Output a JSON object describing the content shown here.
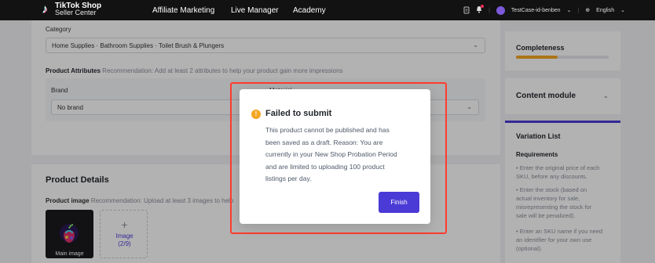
{
  "colors": {
    "accent": "#4b3bd6",
    "warning": "#f5a623",
    "highlight": "#ff3b30",
    "topbar": "#121212"
  },
  "topbar": {
    "logo_line1": "TikTok Shop",
    "logo_line2": "Seller Center",
    "nav": [
      "Affiliate Marketing",
      "Live Manager",
      "Academy"
    ],
    "store_name": "TestCase-id-benben",
    "language": "English"
  },
  "main": {
    "category_label": "Category",
    "category_value": "Home Supplies · Bathroom Supplies · Toilet Brush & Plungers",
    "attributes_label": "Product Attributes",
    "attributes_hint": "Recommendation: Add at least 2 attributes to help your product gain more impressions",
    "brand_label": "Brand",
    "material_label": "Material",
    "brand_value": "No brand",
    "product_details_title": "Product Details",
    "product_image_label": "Product image",
    "product_image_hint": "Recommendation: Upload at least 3 images to help",
    "main_image_caption": "Main image",
    "upload_label": "Image",
    "upload_count": "(2/9)"
  },
  "sidebar": {
    "completeness_title": "Completeness",
    "completeness_progress": 0.45,
    "content_module_title": "Content module",
    "variation_title": "Variation List",
    "requirements_title": "Requirements",
    "requirements_lines": [
      "• Enter the original price of each",
      "SKU, before any discounts.",
      "• Enter the stock (based on",
      "actual inventory for sale,",
      "misrepresenting the stock for",
      "sale will be penalized).",
      "• Enter an SKU name if you need",
      "an identifier for your own use",
      "(optional)."
    ]
  },
  "modal": {
    "title": "Failed to submit",
    "body_lines": [
      "This product cannot be published and has",
      "been saved as a draft. Reason: You are",
      "currently in your New Shop Probation Period",
      "and are limited to uploading 100 product",
      "listings per day."
    ],
    "finish_label": "Finish",
    "warning_glyph": "!"
  }
}
